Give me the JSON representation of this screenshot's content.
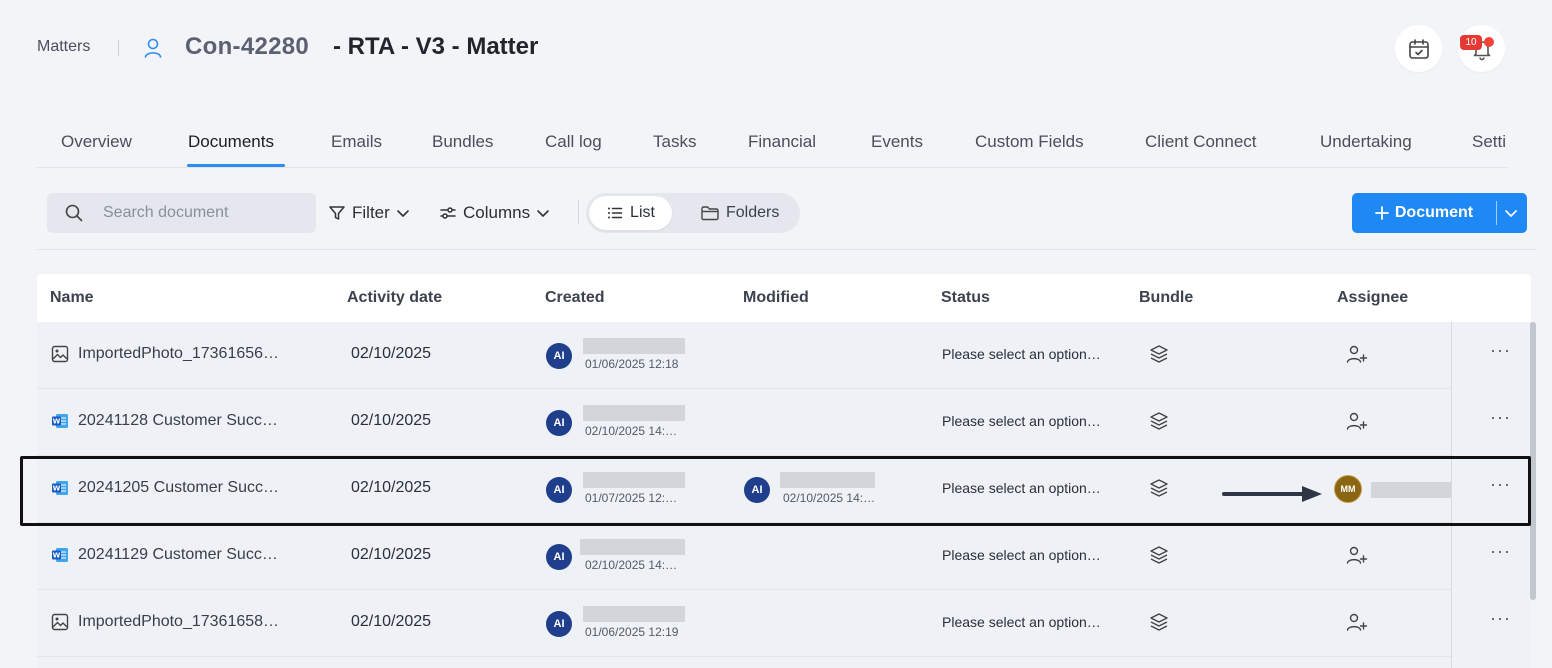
{
  "header": {
    "breadcrumb": "Matters",
    "matter_id": "Con-42280",
    "matter_title": "- RTA - V3 - Matter",
    "notification_count": "10"
  },
  "tabs": [
    {
      "label": "Overview"
    },
    {
      "label": "Documents"
    },
    {
      "label": "Emails"
    },
    {
      "label": "Bundles"
    },
    {
      "label": "Call log"
    },
    {
      "label": "Tasks"
    },
    {
      "label": "Financial"
    },
    {
      "label": "Events"
    },
    {
      "label": "Custom Fields"
    },
    {
      "label": "Client Connect"
    },
    {
      "label": "Undertaking"
    },
    {
      "label": "Setti"
    }
  ],
  "active_tab": "Documents",
  "toolbar": {
    "search_placeholder": "Search document",
    "filter_label": "Filter",
    "columns_label": "Columns",
    "view_list_label": "List",
    "view_folders_label": "Folders",
    "add_document_label": "Document"
  },
  "table": {
    "columns": [
      "Name",
      "Activity date",
      "Created",
      "Modified",
      "Status",
      "Bundle",
      "Assignee"
    ],
    "rows": [
      {
        "type": "image",
        "name": "ImportedPhoto_17361656…",
        "activity_date": "02/10/2025",
        "created_initials": "AI",
        "created_ts": "01/06/2025 12:18",
        "modified_initials": "",
        "modified_ts": "",
        "status": "Please select an option…",
        "assignee_initials": ""
      },
      {
        "type": "word",
        "name": "20241128 Customer Succ…",
        "activity_date": "02/10/2025",
        "created_initials": "AI",
        "created_ts": "02/10/2025 14:…",
        "modified_initials": "",
        "modified_ts": "",
        "status": "Please select an option…",
        "assignee_initials": ""
      },
      {
        "type": "word",
        "name": "20241205 Customer Succ…",
        "activity_date": "02/10/2025",
        "created_initials": "AI",
        "created_ts": "01/07/2025 12:…",
        "modified_initials": "AI",
        "modified_ts": "02/10/2025 14:…",
        "status": "Please select an option…",
        "assignee_initials": "MM"
      },
      {
        "type": "word",
        "name": "20241129 Customer Succ…",
        "activity_date": "02/10/2025",
        "created_initials": "AI",
        "created_ts": "02/10/2025 14:…",
        "modified_initials": "",
        "modified_ts": "",
        "status": "Please select an option…",
        "assignee_initials": ""
      },
      {
        "type": "image",
        "name": "ImportedPhoto_17361658…",
        "activity_date": "02/10/2025",
        "created_initials": "AI",
        "created_ts": "01/06/2025 12:19",
        "modified_initials": "",
        "modified_ts": "",
        "status": "Please select an option…",
        "assignee_initials": ""
      }
    ]
  },
  "colors": {
    "accent": "#1e88f5",
    "avatar": "#1f3e8c",
    "assignee_avatar": "#8a6512",
    "badge": "#e53935"
  }
}
